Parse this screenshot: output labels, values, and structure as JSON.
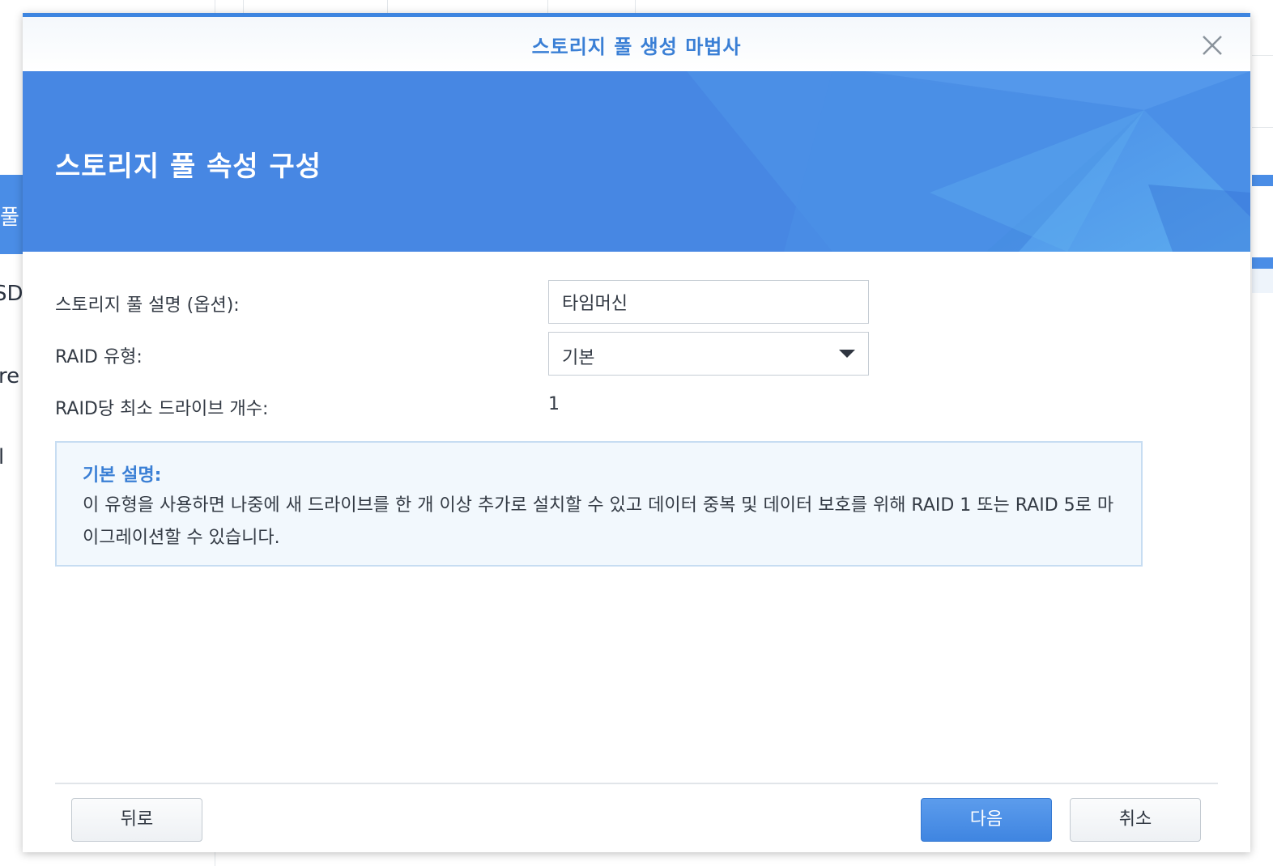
{
  "background": {
    "sidebar_fragments": [
      "풀",
      "SD",
      "re",
      "l"
    ]
  },
  "dialog": {
    "title": "스토리지 풀 생성 마법사",
    "close_icon": "close-icon",
    "banner_title": "스토리지 풀 속성 구성",
    "form": {
      "description": {
        "label": "스토리지 풀 설명 (옵션):",
        "value": "타임머신"
      },
      "raid_type": {
        "label": "RAID 유형:",
        "selected": "기본"
      },
      "min_drives": {
        "label": "RAID당 최소 드라이브 개수:",
        "value": "1"
      }
    },
    "info": {
      "title": "기본 설명:",
      "text": "이 유형을 사용하면 나중에 새 드라이브를 한 개 이상 추가로 설치할 수 있고 데이터 중복 및 데이터 보호를 위해 RAID 1 또는 RAID 5로 마이그레이션할 수 있습니다."
    },
    "buttons": {
      "back": "뒤로",
      "next": "다음",
      "cancel": "취소"
    },
    "colors": {
      "accent": "#3d85e0",
      "banner": "#4787e3",
      "primary_button": "#4a8de6",
      "info_bg": "#f2f8fd"
    }
  }
}
